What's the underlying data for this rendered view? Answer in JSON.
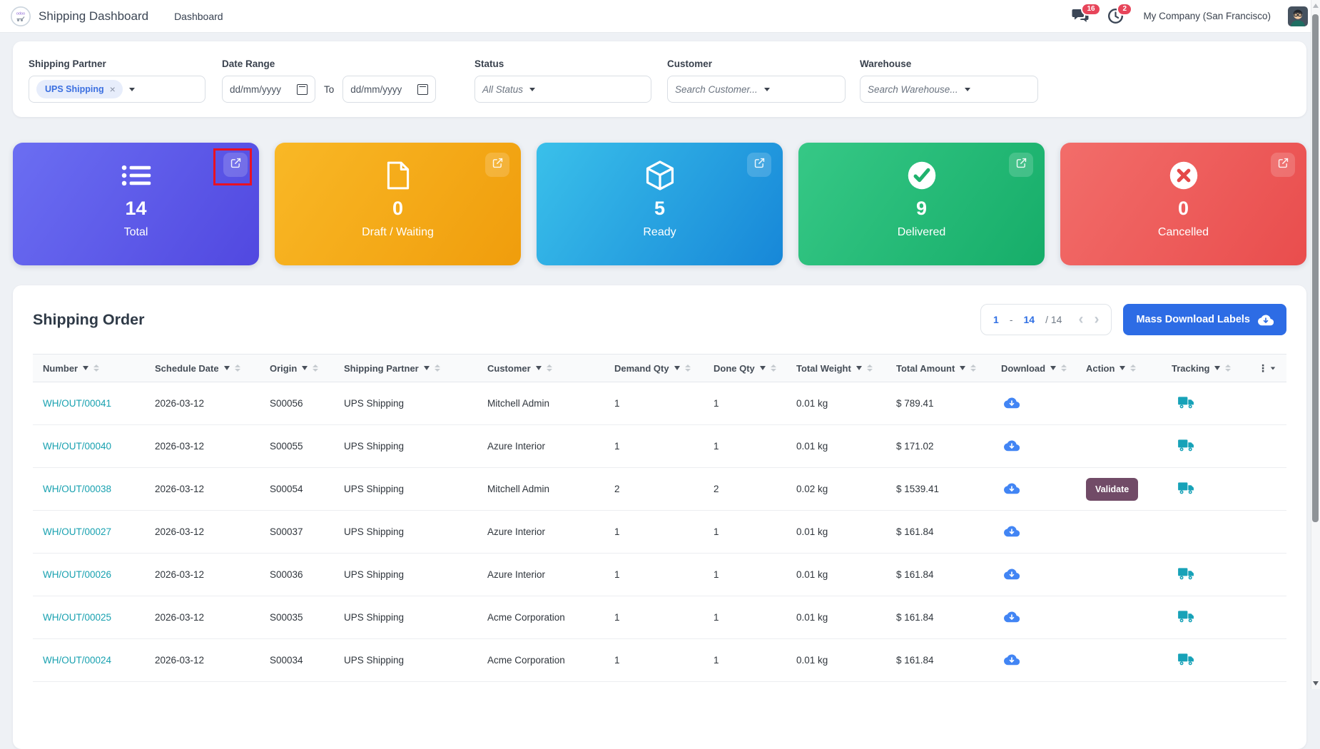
{
  "nav": {
    "title": "Shipping Dashboard",
    "menu": "Dashboard",
    "chat_badge": "16",
    "activity_badge": "2",
    "company": "My Company (San Francisco)"
  },
  "filters": {
    "shipping_partner": {
      "label": "Shipping Partner",
      "tag": "UPS Shipping",
      "remove_icon": "×"
    },
    "date_range": {
      "label": "Date Range",
      "from_placeholder": "dd/mm/yyyy",
      "to_label": "To",
      "to_placeholder": "dd/mm/yyyy"
    },
    "status": {
      "label": "Status",
      "value": "All Status"
    },
    "customer": {
      "label": "Customer",
      "placeholder": "Search Customer..."
    },
    "warehouse": {
      "label": "Warehouse",
      "placeholder": "Search Warehouse..."
    }
  },
  "cards": [
    {
      "value": "14",
      "label": "Total",
      "icon": "list-icon",
      "color_from": "#6b6ef2",
      "color_to": "#5148e0",
      "annotated": true
    },
    {
      "value": "0",
      "label": "Draft / Waiting",
      "icon": "file-icon",
      "color_from": "#f9b826",
      "color_to": "#f09d0c",
      "annotated": false
    },
    {
      "value": "5",
      "label": "Ready",
      "icon": "package-icon",
      "color_from": "#3ac0ea",
      "color_to": "#1787d8",
      "annotated": false
    },
    {
      "value": "9",
      "label": "Delivered",
      "icon": "check-circle-icon",
      "color_from": "#36c886",
      "color_to": "#16ad69",
      "annotated": false
    },
    {
      "value": "0",
      "label": "Cancelled",
      "icon": "x-circle-icon",
      "color_from": "#f26d6a",
      "color_to": "#e94d4d",
      "annotated": false
    }
  ],
  "orders": {
    "title": "Shipping Order",
    "pagination": {
      "start": "1",
      "separator": "-",
      "end": "14",
      "total": "/ 14"
    },
    "mass_download_label": "Mass Download Labels",
    "columns": [
      {
        "label": "Number",
        "sort": "desc"
      },
      {
        "label": "Schedule Date",
        "sort": null
      },
      {
        "label": "Origin",
        "sort": "both"
      },
      {
        "label": "Shipping Partner",
        "sort": "both"
      },
      {
        "label": "Customer",
        "sort": "both"
      },
      {
        "label": "Demand Qty",
        "sort": null
      },
      {
        "label": "Done Qty",
        "sort": null
      },
      {
        "label": "Total Weight",
        "sort": null
      },
      {
        "label": "Total Amount",
        "sort": null
      },
      {
        "label": "Download",
        "sort": null
      },
      {
        "label": "Action",
        "sort": null
      },
      {
        "label": "Tracking",
        "sort": null
      }
    ],
    "rows": [
      {
        "number": "WH/OUT/00041",
        "schedule_date": "2026-03-12",
        "origin": "S00056",
        "shipping_partner": "UPS Shipping",
        "customer": "Mitchell Admin",
        "demand_qty": "1",
        "done_qty": "1",
        "total_weight": "0.01 kg",
        "total_amount": "$ 789.41",
        "download": true,
        "action": "",
        "tracking": true
      },
      {
        "number": "WH/OUT/00040",
        "schedule_date": "2026-03-12",
        "origin": "S00055",
        "shipping_partner": "UPS Shipping",
        "customer": "Azure Interior",
        "demand_qty": "1",
        "done_qty": "1",
        "total_weight": "0.01 kg",
        "total_amount": "$ 171.02",
        "download": true,
        "action": "",
        "tracking": true
      },
      {
        "number": "WH/OUT/00038",
        "schedule_date": "2026-03-12",
        "origin": "S00054",
        "shipping_partner": "UPS Shipping",
        "customer": "Mitchell Admin",
        "demand_qty": "2",
        "done_qty": "2",
        "total_weight": "0.02 kg",
        "total_amount": "$ 1539.41",
        "download": true,
        "action": "Validate",
        "tracking": true
      },
      {
        "number": "WH/OUT/00027",
        "schedule_date": "2026-03-12",
        "origin": "S00037",
        "shipping_partner": "UPS Shipping",
        "customer": "Azure Interior",
        "demand_qty": "1",
        "done_qty": "1",
        "total_weight": "0.01 kg",
        "total_amount": "$ 161.84",
        "download": true,
        "action": "",
        "tracking": false
      },
      {
        "number": "WH/OUT/00026",
        "schedule_date": "2026-03-12",
        "origin": "S00036",
        "shipping_partner": "UPS Shipping",
        "customer": "Azure Interior",
        "demand_qty": "1",
        "done_qty": "1",
        "total_weight": "0.01 kg",
        "total_amount": "$ 161.84",
        "download": true,
        "action": "",
        "tracking": true
      },
      {
        "number": "WH/OUT/00025",
        "schedule_date": "2026-03-12",
        "origin": "S00035",
        "shipping_partner": "UPS Shipping",
        "customer": "Acme Corporation",
        "demand_qty": "1",
        "done_qty": "1",
        "total_weight": "0.01 kg",
        "total_amount": "$ 161.84",
        "download": true,
        "action": "",
        "tracking": true
      },
      {
        "number": "WH/OUT/00024",
        "schedule_date": "2026-03-12",
        "origin": "S00034",
        "shipping_partner": "UPS Shipping",
        "customer": "Acme Corporation",
        "demand_qty": "1",
        "done_qty": "1",
        "total_weight": "0.01 kg",
        "total_amount": "$ 161.84",
        "download": true,
        "action": "",
        "tracking": true
      }
    ]
  },
  "icons": {
    "kebab": "⋮",
    "chevron_left": "‹",
    "chevron_right": "›"
  },
  "colors": {
    "accent_blue": "#2d6ce5",
    "link_teal": "#18a1b0",
    "validate_plum": "#714B67",
    "badge_red": "#e7455a",
    "annotation_red": "#e81123",
    "download_blue": "#4285f4",
    "truck_teal": "#17a2b8"
  }
}
